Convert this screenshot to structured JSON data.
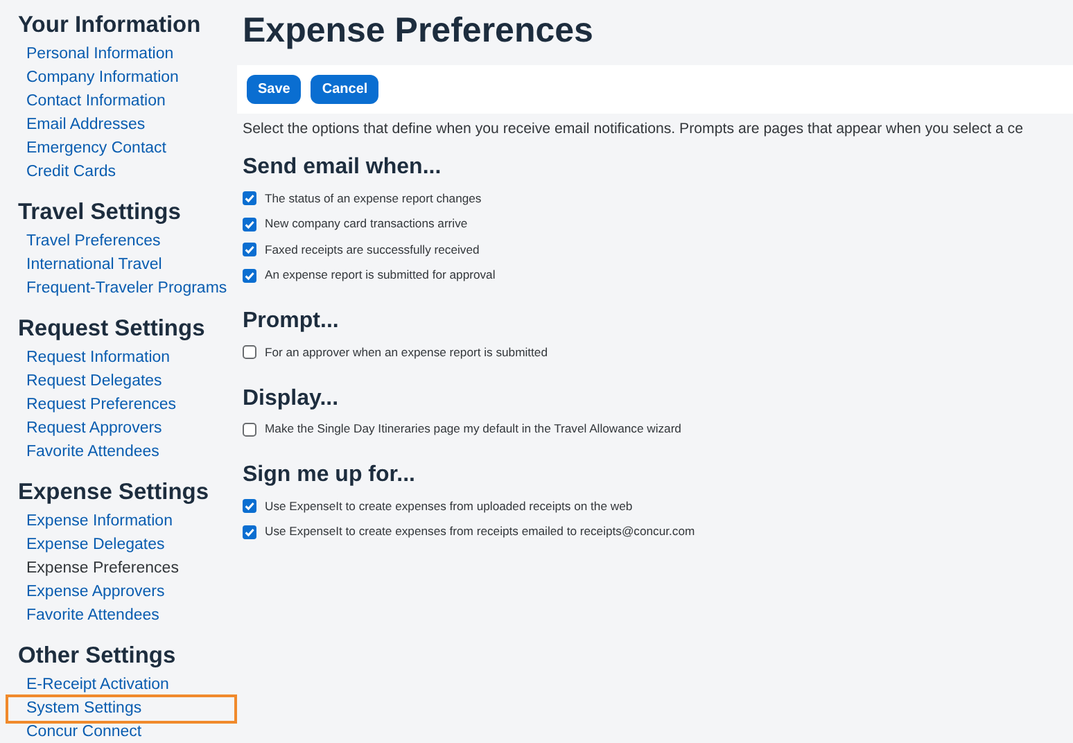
{
  "sidebar": {
    "sections": [
      {
        "title": "Your Information",
        "items": [
          {
            "label": "Personal Information",
            "selected": false,
            "highlighted": false
          },
          {
            "label": "Company Information",
            "selected": false,
            "highlighted": false
          },
          {
            "label": "Contact Information",
            "selected": false,
            "highlighted": false
          },
          {
            "label": "Email Addresses",
            "selected": false,
            "highlighted": false
          },
          {
            "label": "Emergency Contact",
            "selected": false,
            "highlighted": false
          },
          {
            "label": "Credit Cards",
            "selected": false,
            "highlighted": false
          }
        ]
      },
      {
        "title": "Travel Settings",
        "items": [
          {
            "label": "Travel Preferences",
            "selected": false,
            "highlighted": false
          },
          {
            "label": "International Travel",
            "selected": false,
            "highlighted": false
          },
          {
            "label": "Frequent-Traveler Programs",
            "selected": false,
            "highlighted": false
          }
        ]
      },
      {
        "title": "Request Settings",
        "items": [
          {
            "label": "Request Information",
            "selected": false,
            "highlighted": false
          },
          {
            "label": "Request Delegates",
            "selected": false,
            "highlighted": false
          },
          {
            "label": "Request Preferences",
            "selected": false,
            "highlighted": false
          },
          {
            "label": "Request Approvers",
            "selected": false,
            "highlighted": false
          },
          {
            "label": "Favorite Attendees",
            "selected": false,
            "highlighted": false
          }
        ]
      },
      {
        "title": "Expense Settings",
        "items": [
          {
            "label": "Expense Information",
            "selected": false,
            "highlighted": false
          },
          {
            "label": "Expense Delegates",
            "selected": false,
            "highlighted": false
          },
          {
            "label": "Expense Preferences",
            "selected": true,
            "highlighted": false
          },
          {
            "label": "Expense Approvers",
            "selected": false,
            "highlighted": false
          },
          {
            "label": "Favorite Attendees",
            "selected": false,
            "highlighted": false
          }
        ]
      },
      {
        "title": "Other Settings",
        "items": [
          {
            "label": "E-Receipt Activation",
            "selected": false,
            "highlighted": false
          },
          {
            "label": "System Settings",
            "selected": false,
            "highlighted": true
          },
          {
            "label": "Concur Connect",
            "selected": false,
            "highlighted": false
          }
        ]
      }
    ]
  },
  "page": {
    "title": "Expense Preferences",
    "buttons": [
      "Save",
      "Cancel"
    ],
    "description": "Select the options that define when you receive email notifications. Prompts are pages that appear when you select a ce",
    "groups": [
      {
        "title": "Send email when...",
        "options": [
          {
            "label": "The status of an expense report changes",
            "checked": true
          },
          {
            "label": "New company card transactions arrive",
            "checked": true
          },
          {
            "label": "Faxed receipts are successfully received",
            "checked": true
          },
          {
            "label": "An expense report is submitted for approval",
            "checked": true
          }
        ]
      },
      {
        "title": "Prompt...",
        "options": [
          {
            "label": "For an approver when an expense report is submitted",
            "checked": false
          }
        ]
      },
      {
        "title": "Display...",
        "options": [
          {
            "label": "Make the Single Day Itineraries page my default in the Travel Allowance wizard",
            "checked": false
          }
        ]
      },
      {
        "title": "Sign me up for...",
        "options": [
          {
            "label": "Use ExpenseIt to create expenses from uploaded receipts on the web",
            "checked": true
          },
          {
            "label": "Use ExpenseIt to create expenses from receipts emailed to receipts@concur.com",
            "checked": true
          }
        ]
      }
    ]
  }
}
